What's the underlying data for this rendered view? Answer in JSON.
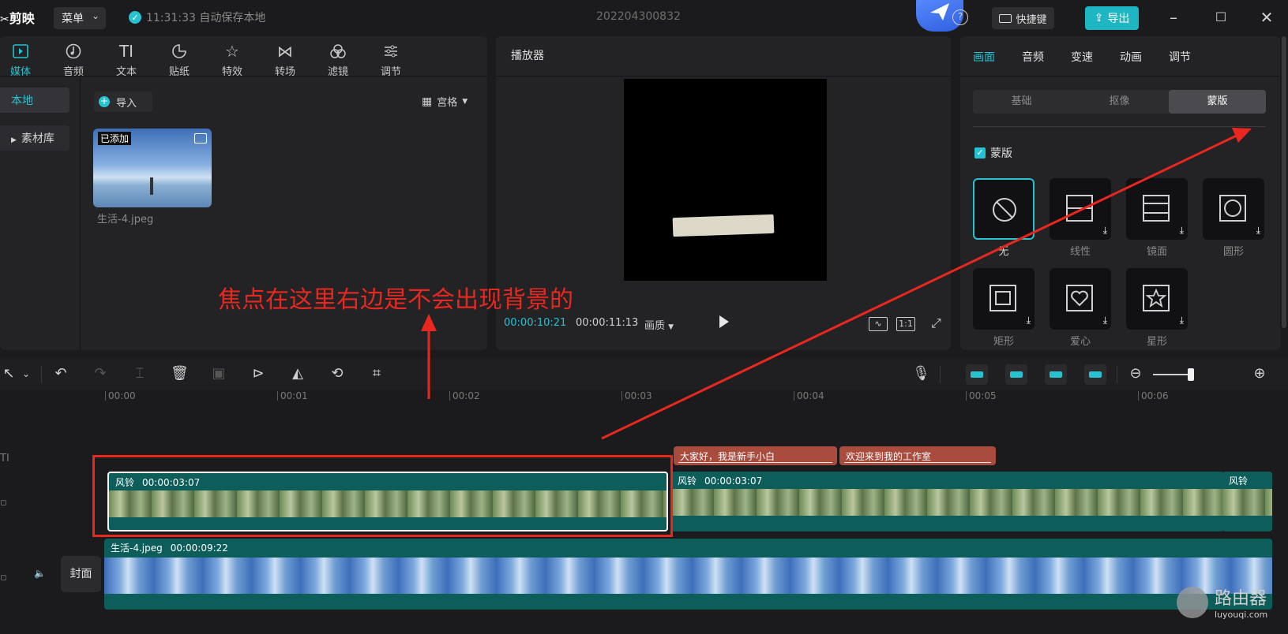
{
  "titlebar": {
    "logo": "剪映",
    "menu_label": "菜单",
    "save_status": "11:31:33 自动保存本地",
    "project_name": "202204300832",
    "shortcut_label": "快捷键",
    "export_label": "导出"
  },
  "media_panel": {
    "tabs": [
      {
        "label": "媒体",
        "icon": "media-icon"
      },
      {
        "label": "音频",
        "icon": "audio-icon"
      },
      {
        "label": "文本",
        "icon": "text-icon"
      },
      {
        "label": "贴纸",
        "icon": "sticker-icon"
      },
      {
        "label": "特效",
        "icon": "effects-icon"
      },
      {
        "label": "转场",
        "icon": "transition-icon"
      },
      {
        "label": "滤镜",
        "icon": "filter-icon"
      },
      {
        "label": "调节",
        "icon": "adjust-icon"
      }
    ],
    "side_items": [
      "本地",
      "素材库"
    ],
    "import_label": "导入",
    "view_label": "宫格",
    "asset": {
      "badge": "已添加",
      "name": "生活-4.jpeg"
    }
  },
  "player": {
    "title": "播放器",
    "current_time": "00:00:10:21",
    "total_time": "00:00:11:13",
    "quality_label": "画质",
    "ratio_label": "1:1"
  },
  "properties": {
    "tabs": [
      "画面",
      "音频",
      "变速",
      "动画",
      "调节"
    ],
    "segments": [
      "基础",
      "抠像",
      "蒙版"
    ],
    "mask_checkbox_label": "蒙版",
    "masks": [
      "无",
      "线性",
      "镜面",
      "圆形",
      "矩形",
      "爱心",
      "星形"
    ]
  },
  "timeline": {
    "ruler_labels": [
      "00:00",
      "00:01",
      "00:02",
      "00:03",
      "00:04",
      "00:05",
      "00:06"
    ],
    "text_clips": [
      "大家好，我是新手小白",
      "欢迎来到我的工作室"
    ],
    "video_clips": [
      {
        "name": "风铃",
        "duration": "00:00:03:07"
      },
      {
        "name": "风铃",
        "duration": "00:00:03:07"
      },
      {
        "name": "风铃",
        "duration": ""
      }
    ],
    "image_clip": {
      "name": "生活-4.jpeg",
      "duration": "00:00:09:22"
    },
    "cover_label": "封面"
  },
  "annotation": {
    "text": "焦点在这里右边是不会出现背景的",
    "color": "#e8281f"
  },
  "watermark": {
    "title": "路由器",
    "url": "luyouqi.com"
  },
  "colors": {
    "accent": "#27c2cf",
    "clip_teal": "#0d5d5a",
    "text_clip_red": "#a94c3e"
  }
}
